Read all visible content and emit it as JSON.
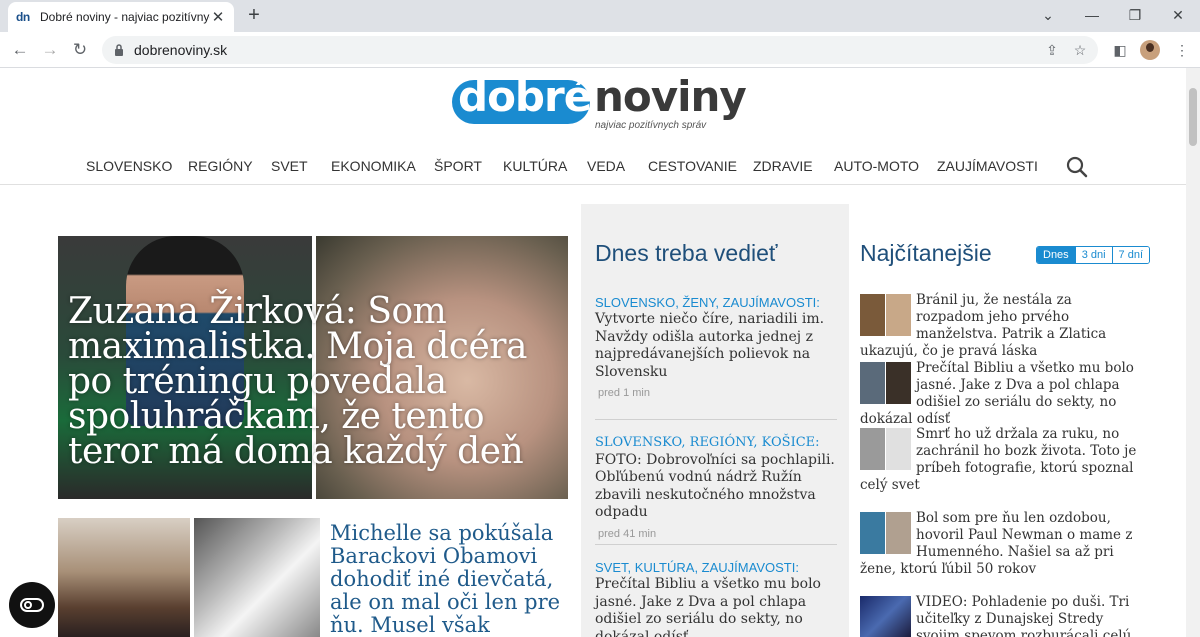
{
  "browser": {
    "tab_title": "Dobré noviny - najviac pozitívnych správ",
    "tab_favicon": "dn",
    "url": "dobrenoviny.sk"
  },
  "site": {
    "logo_left": "dobré",
    "logo_right": "noviny",
    "tagline": "najviac pozitívnych správ"
  },
  "nav": [
    "SLOVENSKO",
    "REGIÓNY",
    "SVET",
    "EKONOMIKA",
    "ŠPORT",
    "KULTÚRA",
    "VEDA",
    "CESTOVANIE",
    "ZDRAVIE",
    "AUTO-MOTO",
    "ZAUJÍMAVOSTI"
  ],
  "hero": {
    "title": "Zuzana Žirková: Som maximalistka. Moja dcéra po tréningu povedala spoluhráčkam, že tento teror má doma každý deň"
  },
  "article2": {
    "title": "Michelle sa pokúšala Barackovi Obamovi dohodiť iné dievčatá, ale on mal oči len pre ňu. Musel však zabojovať"
  },
  "must_know": {
    "heading": "Dnes treba vedieť",
    "items": [
      {
        "cats": "SLOVENSKO, ŽENY, ZAUJÍMAVOSTI:",
        "text": "Vytvorte niečo číre, nariadili im. Navždy odišla autorka jednej z najpredávanejších polievok na Slovensku",
        "time": "pred 1 min"
      },
      {
        "cats": "SLOVENSKO, REGIÓNY, KOŠICE:",
        "text": "FOTO: Dobrovoľníci sa pochlapili. Obľúbenú vodnú nádrž Ružín zbavili neskutočného množstva odpadu",
        "time": "pred 41 min"
      },
      {
        "cats": "SVET, KULTÚRA, ZAUJÍMAVOSTI:",
        "text": "Prečítal Bibliu a všetko mu bolo jasné. Jake z Dva a pol chlapa odišiel zo seriálu do sekty, no dokázal odísť"
      }
    ]
  },
  "popular": {
    "heading": "Najčítanejšie",
    "tabs": [
      "Dnes",
      "3 dni",
      "7 dní"
    ],
    "items": [
      "Bránil ju, že nestála za rozpadom jeho prvého manželstva. Patrik a Zlatica ukazujú, čo je pravá láska",
      "Prečítal Bibliu a všetko mu bolo jasné. Jake z Dva a pol chlapa odišiel zo seriálu do sekty, no dokázal odísť",
      "Smrť ho už držala za ruku, no zachránil ho bozk života. Toto je príbeh fotografie, ktorú spoznal celý svet",
      "Bol som pre ňu len ozdobou, hovoril Paul Newman o mame z Humenného. Našiel sa až pri žene, ktorú ľúbil 50 rokov",
      "VIDEO: Pohladenie po duši. Tri učiteľky z Dunajskej Stredy svojim spevom rozburácali celú Inchebu"
    ]
  },
  "colors": {
    "brand_blue": "#1a8bd0",
    "heading_blue": "#1f4f7a",
    "logo_dark": "#3a3a3a"
  }
}
